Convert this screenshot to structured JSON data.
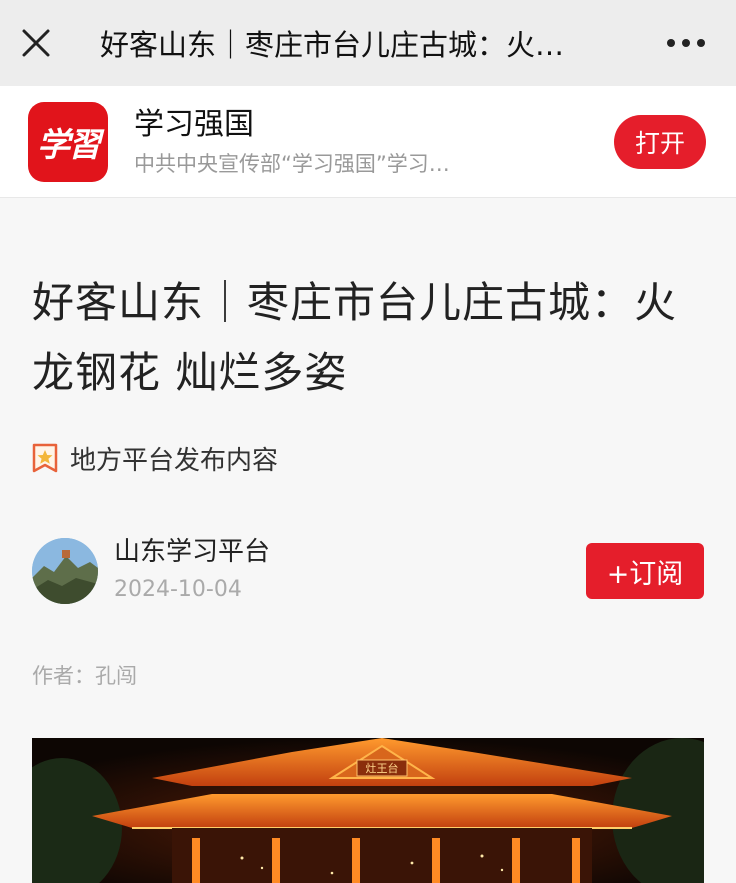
{
  "topbar": {
    "title": "好客山东｜枣庄市台儿庄古城：火…",
    "close_icon": "close-icon",
    "more_icon": "more-icon"
  },
  "app_banner": {
    "logo_text": "学習",
    "name": "学习强国",
    "description": "中共中央宣传部“学习强国”学习…",
    "open_label": "打开",
    "accent_color": "#e51e2b"
  },
  "article": {
    "title": "好客山东｜枣庄市台儿庄古城：火龙钢花 灿烂多姿",
    "source_label": "地方平台发布内容",
    "author": {
      "name": "山东学习平台",
      "date": "2024-10-04",
      "subscribe_label": "+订阅"
    },
    "byline": "作者：孔闯",
    "image_sign": "灶王台"
  }
}
